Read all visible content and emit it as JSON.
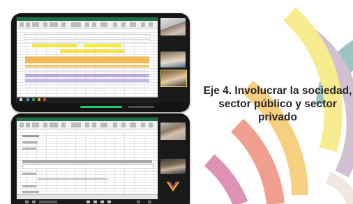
{
  "heading": {
    "line1": "Eje 4. Involucrar la sociedad,",
    "line2": "sector público y sector",
    "line3": "privado"
  },
  "colors": {
    "excel_green": "#1e7145",
    "zoom_active_green": "#22c96a",
    "tablet_frame": "#141414",
    "arc_yellow": "#f1e04a",
    "arc_orange": "#f2b233",
    "arc_red": "#e8654b",
    "arc_magenta": "#c94f86",
    "arc_purple": "#9c6fa6",
    "arc_teal": "#5fa0a0"
  },
  "icons": [
    "excel-window",
    "video-participant",
    "zoom-controls",
    "logo-mark"
  ]
}
